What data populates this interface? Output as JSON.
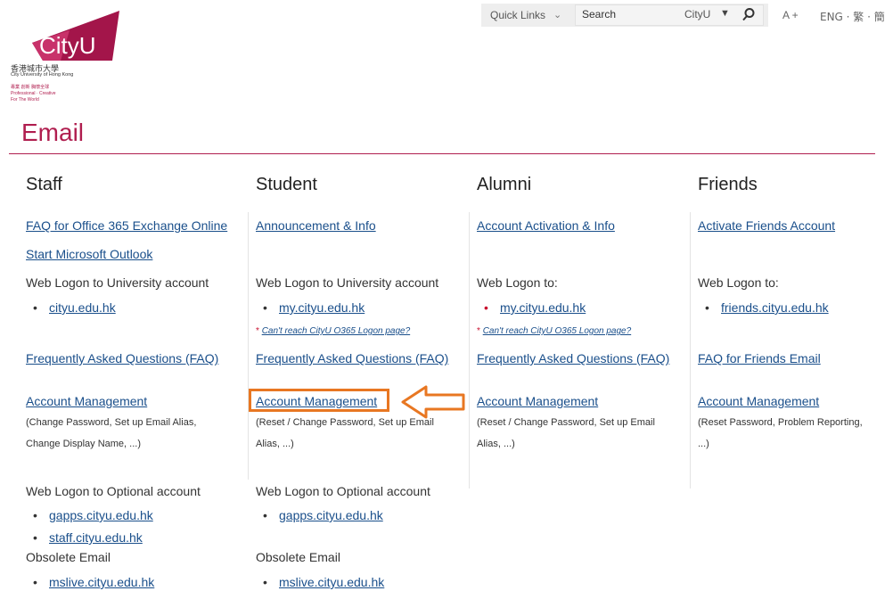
{
  "header": {
    "logo": {
      "wordmark": "CityU",
      "name_cn": "香港城市大學",
      "name_en": "City University of Hong Kong",
      "tagline_cn": "專業 創新 胸懷全球",
      "tagline_en1": "Professional · Creative",
      "tagline_en2": "For The World"
    },
    "quick_links": "Quick Links",
    "search_placeholder": "Search",
    "search_scope": "CityU",
    "font_size_label": "A +",
    "languages": "ENG · 繁 · 簡"
  },
  "page_title": "Email",
  "columns": {
    "staff": {
      "heading": "Staff",
      "faq_o365": "FAQ for Office 365 Exchange Online",
      "start_outlook": "Start Microsoft Outlook",
      "web_logon": "Web Logon to University account",
      "web_logon_link": "cityu.edu.hk",
      "faq": "Frequently Asked Questions (FAQ)",
      "account_mgmt": "Account Management",
      "account_mgmt_desc": "(Change Password, Set up Email Alias, Change Display Name, ...)",
      "optional_logon": "Web Logon to Optional account",
      "optional_links": [
        "gapps.cityu.edu.hk",
        "staff.cityu.edu.hk"
      ],
      "obsolete": "Obsolete Email",
      "obsolete_link": "mslive.cityu.edu.hk"
    },
    "student": {
      "heading": "Student",
      "announcement": "Announcement & Info",
      "web_logon": "Web Logon to University account",
      "web_logon_link": "my.cityu.edu.hk",
      "note": "Can't reach CityU O365 Logon page?",
      "faq": "Frequently Asked Questions (FAQ)",
      "account_mgmt": "Account Management",
      "account_mgmt_desc": "(Reset / Change Password, Set up Email Alias, ...)",
      "optional_logon": "Web Logon to Optional account",
      "optional_link": "gapps.cityu.edu.hk",
      "obsolete": "Obsolete Email",
      "obsolete_link": "mslive.cityu.edu.hk"
    },
    "alumni": {
      "heading": "Alumni",
      "activation": "Account Activation & Info",
      "web_logon": "Web Logon to:",
      "web_logon_link": "my.cityu.edu.hk",
      "note": "Can't reach CityU O365 Logon page?",
      "faq": "Frequently Asked Questions (FAQ)",
      "account_mgmt": "Account Management",
      "account_mgmt_desc": "(Reset / Change Password, Set up Email Alias, ...)"
    },
    "friends": {
      "heading": "Friends",
      "activate": "Activate Friends Account",
      "web_logon": "Web Logon to:",
      "web_logon_link": "friends.cityu.edu.hk",
      "faq": "FAQ for Friends Email",
      "account_mgmt": "Account Management",
      "account_mgmt_desc": "(Reset Password, Problem Reporting, ...)"
    }
  },
  "colors": {
    "brand": "#b01e4f",
    "link": "#1a4f8b",
    "highlight": "#e87722"
  },
  "bullet": "•",
  "note_star": "*"
}
